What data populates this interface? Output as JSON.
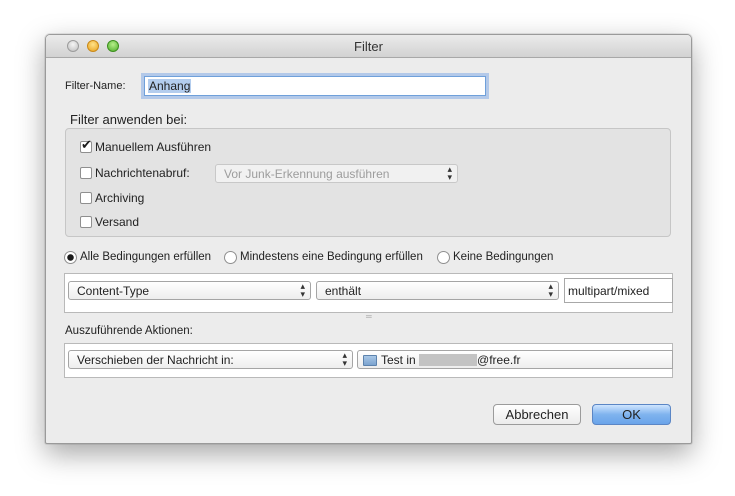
{
  "window": {
    "title": "Filter"
  },
  "filter_name": {
    "label": "Filter-Name:",
    "value": "Anhang"
  },
  "apply_section": {
    "heading": "Filter anwenden bei:",
    "options": [
      {
        "label": "Manuellem Ausführen",
        "checked": true
      },
      {
        "label": "Nachrichtenabruf:",
        "checked": false
      },
      {
        "label": "Archiving",
        "checked": false
      },
      {
        "label": "Versand",
        "checked": false
      }
    ],
    "junk_popup": {
      "value": "Vor Junk-Erkennung ausführen",
      "enabled": false
    }
  },
  "match_mode": {
    "options": [
      {
        "label": "Alle Bedingungen erfüllen",
        "selected": true
      },
      {
        "label": "Mindestens eine Bedingung erfüllen",
        "selected": false
      },
      {
        "label": "Keine Bedingungen",
        "selected": false
      }
    ]
  },
  "conditions": [
    {
      "field": "Content-Type",
      "operator": "enthält",
      "value": "multipart/mixed"
    }
  ],
  "actions": {
    "label": "Auszuführende Aktionen:",
    "items": [
      {
        "action": "Verschieben der Nachricht in:",
        "target_prefix": "Test in",
        "target_suffix": "@free.fr",
        "target_icon": "folder-icon"
      }
    ]
  },
  "buttons": {
    "cancel": "Abbrechen",
    "ok": "OK"
  },
  "colors": {
    "window_bg": "#ececec",
    "default_button": "#7fb3ee",
    "focus_ring": "#6fa0da"
  }
}
